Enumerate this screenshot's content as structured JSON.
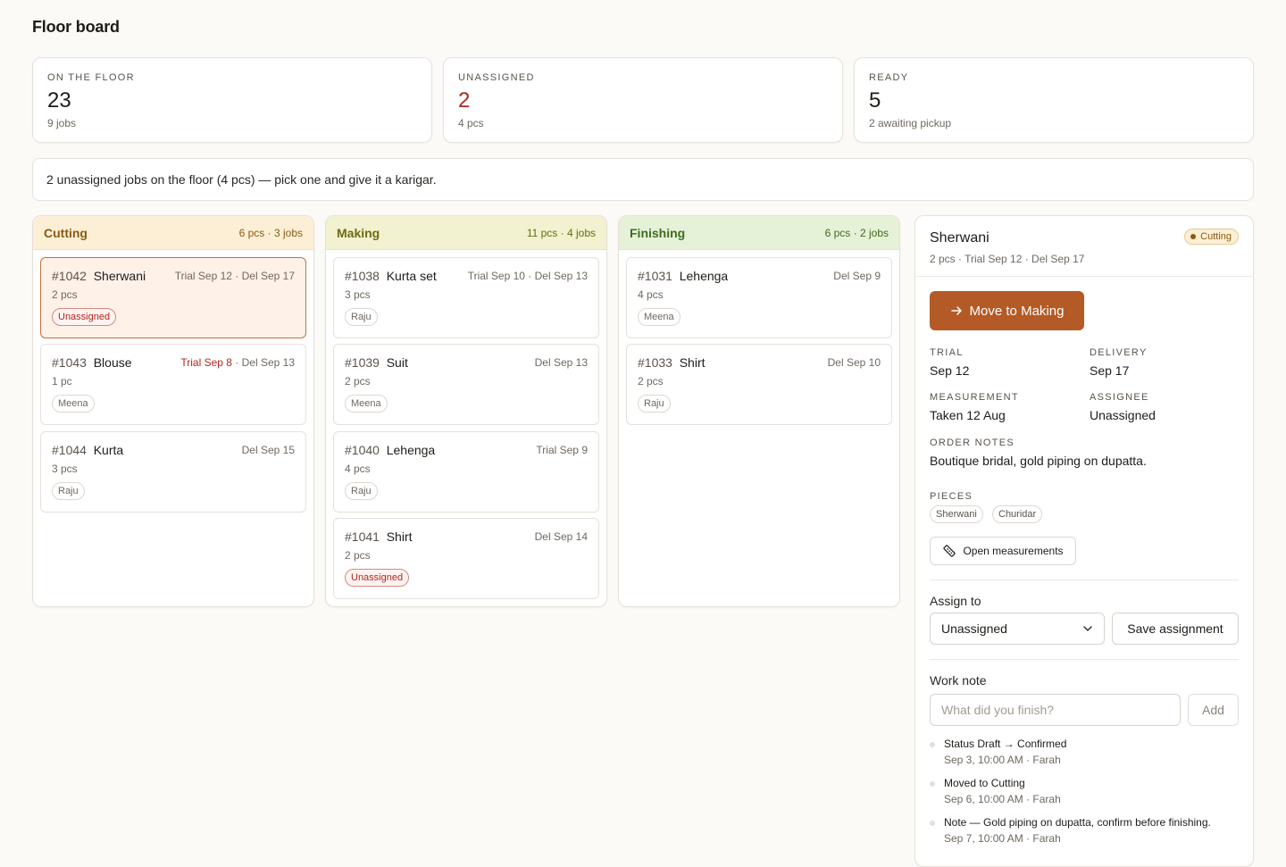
{
  "page": {
    "title": "Floor board"
  },
  "stats": [
    {
      "label": "ON THE FLOOR",
      "value": "23",
      "sub": "9 jobs"
    },
    {
      "label": "UNASSIGNED",
      "value": "2",
      "sub": "4 pcs"
    },
    {
      "label": "READY",
      "value": "5",
      "sub": "2 awaiting pickup"
    }
  ],
  "banner": {
    "text": "2 unassigned jobs on the floor (4 pcs) — pick one and give it a karigar."
  },
  "columns": {
    "cutting": {
      "name": "Cutting",
      "meta": "6 pcs · 3 jobs",
      "cards": [
        {
          "id": "#1042",
          "name": "Sherwani",
          "trial": "Trial Sep 12",
          "sep": " · ",
          "delivery": "Del Sep 17",
          "pcs": "2 pcs",
          "assignee": "Unassigned"
        },
        {
          "id": "#1043",
          "name": "Blouse",
          "trial": "Trial Sep 8",
          "sep": " · ",
          "delivery": "Del Sep 13",
          "pcs": "1 pc",
          "assignee": "Meena"
        },
        {
          "id": "#1044",
          "name": "Kurta",
          "delivery": "Del Sep 15",
          "pcs": "3 pcs",
          "assignee": "Raju"
        }
      ]
    },
    "making": {
      "name": "Making",
      "meta": "11 pcs · 4 jobs",
      "cards": [
        {
          "id": "#1038",
          "name": "Kurta set",
          "trial": "Trial Sep 10",
          "sep": " · ",
          "delivery": "Del Sep 13",
          "pcs": "3 pcs",
          "assignee": "Raju"
        },
        {
          "id": "#1039",
          "name": "Suit",
          "delivery": "Del Sep 13",
          "pcs": "2 pcs",
          "assignee": "Meena"
        },
        {
          "id": "#1040",
          "name": "Lehenga",
          "delivery": "Trial Sep 9",
          "pcs": "4 pcs",
          "assignee": "Raju"
        },
        {
          "id": "#1041",
          "name": "Shirt",
          "delivery": "Del Sep 14",
          "pcs": "2 pcs",
          "assignee": "Unassigned"
        }
      ]
    },
    "finishing": {
      "name": "Finishing",
      "meta": "6 pcs · 2 jobs",
      "cards": [
        {
          "id": "#1031",
          "name": "Lehenga",
          "delivery": "Del Sep 9",
          "pcs": "4 pcs",
          "assignee": "Meena"
        },
        {
          "id": "#1033",
          "name": "Shirt",
          "delivery": "Del Sep 10",
          "pcs": "2 pcs",
          "assignee": "Raju"
        }
      ]
    }
  },
  "detail": {
    "title": "Sherwani",
    "badge": "Cutting",
    "sub": "2 pcs · Trial Sep 12 · Del Sep 17",
    "move_label": "Move to Making",
    "trial_label": "TRIAL",
    "trial_value": "Sep 12",
    "delivery_label": "DELIVERY",
    "delivery_value": "Sep 17",
    "measurement_label": "MEASUREMENT",
    "measurement_value": "Taken 12 Aug",
    "assignee_label": "ASSIGNEE",
    "assignee_value": "Unassigned",
    "notes_label": "ORDER NOTES",
    "notes_value": "Boutique bridal, gold piping on dupatta.",
    "pieces_label": "PIECES",
    "pieces": [
      "Sherwani",
      "Churidar"
    ],
    "open_measurements_label": "Open measurements",
    "assign_label": "Assign to",
    "assign_value": "Unassigned",
    "save_label": "Save assignment",
    "work_note_label": "Work note",
    "work_note_placeholder": "What did you finish?",
    "add_label": "Add",
    "activity": [
      {
        "title": "Status Draft → Confirmed",
        "meta": "Sep 3, 10:00 AM · Farah"
      },
      {
        "title": "Moved to Cutting",
        "meta": "Sep 6, 10:00 AM · Farah"
      },
      {
        "title": "Note — Gold piping on dupatta, confirm before finishing.",
        "meta": "Sep 7, 10:00 AM · Farah"
      }
    ]
  },
  "colors": {
    "accent": "#b35a26",
    "danger": "#b3261e",
    "cutting": "#fcefd6",
    "making": "#f2f1d0",
    "finishing": "#e6f2d8"
  },
  "icons": {
    "move": "arrow-right-icon",
    "measure": "ruler-icon",
    "select": "chevron-down-icon"
  }
}
